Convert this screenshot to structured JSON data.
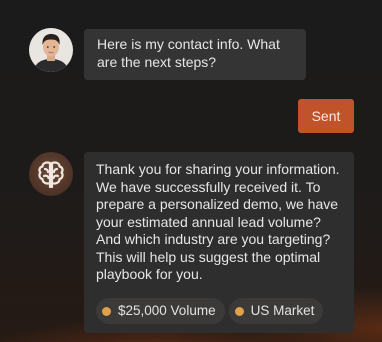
{
  "conversation": {
    "user_message": {
      "text": "Here is my contact info. What are the next steps?",
      "avatar": "user-photo"
    },
    "sent_button": {
      "label": "Sent",
      "color": "#c0532a"
    },
    "bot_message": {
      "text": "Thank you for sharing your information. We have successfully received it. To prepare a personalized demo, we have your estimated annual lead volume? And which industry are you targeting? This will help us suggest the optimal playbook for you.",
      "avatar": "brain-icon",
      "tags": [
        {
          "label": "$25,000 Volume",
          "dot_color": "#e0a04c"
        },
        {
          "label": "US Market",
          "dot_color": "#e0a04c"
        }
      ]
    }
  },
  "colors": {
    "accent": "#c0532a",
    "bubble": "#343434",
    "tag_dot": "#e0a04c"
  }
}
